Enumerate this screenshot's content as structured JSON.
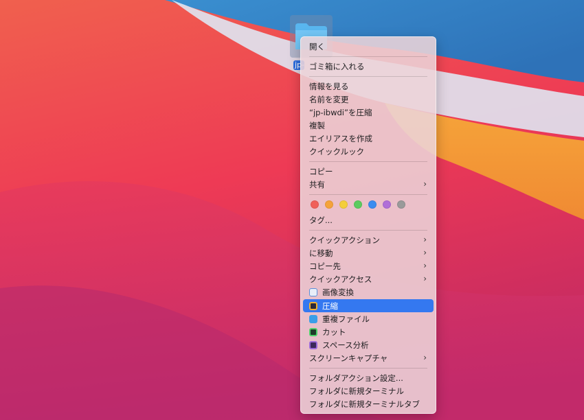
{
  "desktop": {
    "folder_name": "jp-ibwdi"
  },
  "menu": {
    "items": [
      {
        "key": "open",
        "label": "開く"
      },
      {
        "key": "trash",
        "label": "ゴミ箱に入れる"
      },
      {
        "key": "info",
        "label": "情報を見る"
      },
      {
        "key": "rename",
        "label": "名前を変更"
      },
      {
        "key": "compress_name",
        "label": "“jp-ibwdi”を圧縮"
      },
      {
        "key": "duplicate",
        "label": "複製"
      },
      {
        "key": "alias",
        "label": "エイリアスを作成"
      },
      {
        "key": "quicklook",
        "label": "クイックルック"
      },
      {
        "key": "copy",
        "label": "コピー"
      },
      {
        "key": "share",
        "label": "共有",
        "submenu": true
      },
      {
        "key": "tags",
        "label": "タグ..."
      },
      {
        "key": "quick_actions",
        "label": "クイックアクション",
        "submenu": true
      },
      {
        "key": "move_to",
        "label": "に移動",
        "submenu": true
      },
      {
        "key": "copy_to",
        "label": "コピー先",
        "submenu": true
      },
      {
        "key": "quick_access",
        "label": "クイックアクセス",
        "submenu": true
      },
      {
        "key": "image_convert",
        "label": "画像変換",
        "icon": "image-convert-icon"
      },
      {
        "key": "compress",
        "label": "圧縮",
        "icon": "archive-icon",
        "selected": true
      },
      {
        "key": "dup_files",
        "label": "重複ファイル",
        "icon": "duplicate-files-icon"
      },
      {
        "key": "cut",
        "label": "カット",
        "icon": "scissors-icon"
      },
      {
        "key": "space",
        "label": "スペース分析",
        "icon": "disk-analyzer-icon"
      },
      {
        "key": "screen_capture",
        "label": "スクリーンキャプチャ",
        "submenu": true
      },
      {
        "key": "folder_action",
        "label": "フォルダアクション設定..."
      },
      {
        "key": "new_terminal",
        "label": "フォルダに新規ターミナル"
      },
      {
        "key": "new_terminal_tab",
        "label": "フォルダに新規ターミナルタブ"
      }
    ],
    "tag_colors": [
      "#f0605a",
      "#f5a33a",
      "#f4ce3b",
      "#5ccb5f",
      "#3a8cf0",
      "#b06fd8",
      "#9a9a9a"
    ],
    "tag_names": [
      "red",
      "orange",
      "yellow",
      "green",
      "blue",
      "purple",
      "gray"
    ],
    "submenu_glyph": "›"
  },
  "colors": {
    "selection": "#3478f0"
  }
}
